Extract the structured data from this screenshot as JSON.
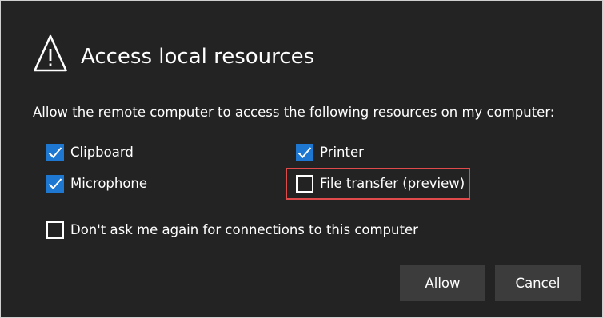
{
  "dialog": {
    "icon": "warning-icon",
    "title": "Access local resources",
    "description": "Allow the remote computer to access the following resources on my computer:"
  },
  "resources": {
    "clipboard": {
      "label": "Clipboard",
      "checked": true
    },
    "printer": {
      "label": "Printer",
      "checked": true
    },
    "microphone": {
      "label": "Microphone",
      "checked": true
    },
    "file_transfer": {
      "label": "File transfer (preview)",
      "checked": false
    }
  },
  "dont_ask": {
    "label": "Don't ask me again for connections to this computer",
    "checked": false
  },
  "buttons": {
    "allow": "Allow",
    "cancel": "Cancel"
  },
  "colors": {
    "background": "#232323",
    "checkbox_checked": "#1e78d2",
    "highlight": "#e04a4a",
    "button": "#3c3c3c"
  }
}
